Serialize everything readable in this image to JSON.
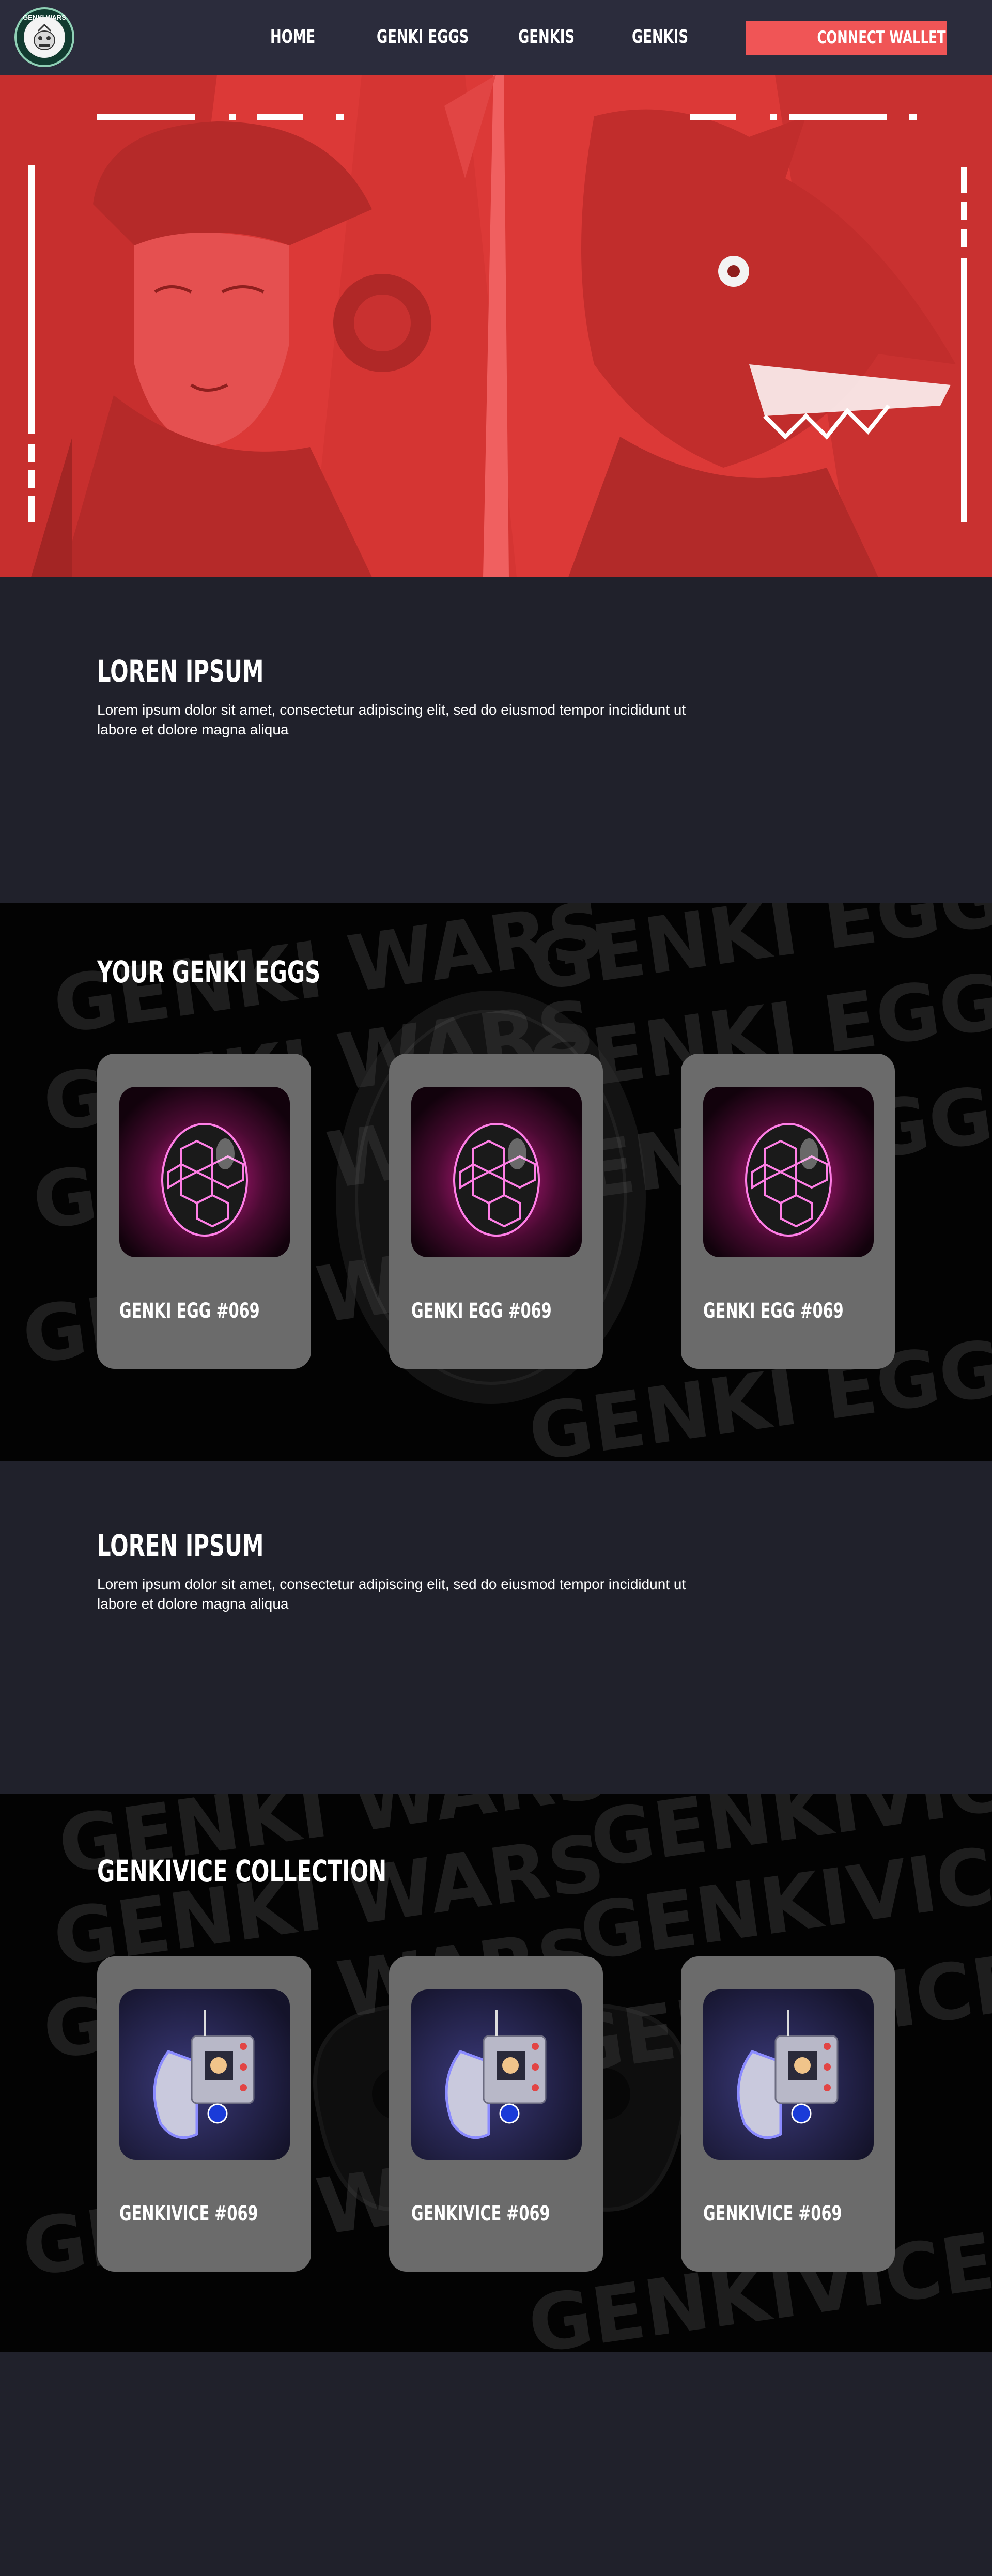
{
  "nav": {
    "logo_text": "GENKI WARS",
    "links": [
      "HOME",
      "GENKI EGGS",
      "GENKIS",
      "GENKIS"
    ],
    "connect_label": "CONNECT WALLET"
  },
  "intro1": {
    "title": "LOREN IPSUM",
    "body": "Lorem ipsum dolor sit amet, consectetur adipiscing elit, sed do eiusmod tempor incididunt ut labore et dolore magna aliqua"
  },
  "eggs": {
    "title": "YOUR GENKI EGGS",
    "watermarks": [
      "GENKI WARS",
      "GENKI EGGS"
    ],
    "cards": [
      {
        "title": "GENKI EGG #069"
      },
      {
        "title": "GENKI EGG #069"
      },
      {
        "title": "GENKI EGG #069"
      }
    ]
  },
  "intro2": {
    "title": "LOREN IPSUM",
    "body": "Lorem ipsum dolor sit amet, consectetur adipiscing elit, sed do eiusmod tempor incididunt ut labore et dolore magna aliqua"
  },
  "genkivice": {
    "title": "GENKIVICE COLLECTION",
    "watermarks": [
      "GENKI WARS",
      "GENKIVICE"
    ],
    "cards": [
      {
        "title": "GENKIVICE #069"
      },
      {
        "title": "GENKIVICE #069"
      },
      {
        "title": "GENKIVICE #069"
      }
    ]
  },
  "colors": {
    "nav_bg": "#2b2c3c",
    "accent": "#f05556",
    "hero_red": "#dc3937",
    "page_bg": "#20212b",
    "card_bg": "#6b6b6b"
  }
}
